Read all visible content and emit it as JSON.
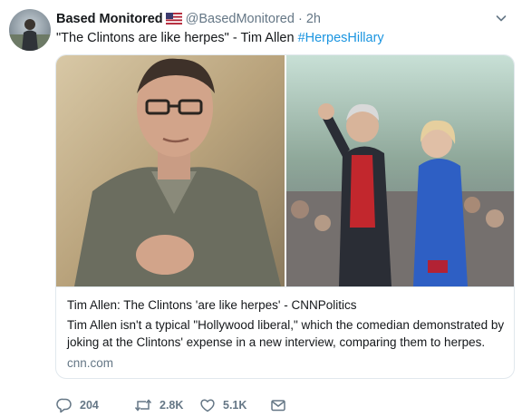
{
  "tweet": {
    "display_name": "Based Monitored",
    "handle": "@BasedMonitored",
    "separator": "·",
    "time": "2h",
    "text": "\"The Clintons are like herpes\" - Tim Allen ",
    "hashtag": "#HerpesHillary"
  },
  "card": {
    "title": "Tim Allen: The Clintons 'are like herpes' - CNNPolitics",
    "description": "Tim Allen isn't a typical \"Hollywood liberal,\" which the comedian demonstrated by joking at the Clintons' expense in a new interview, comparing them to herpes.",
    "domain": "cnn.com"
  },
  "actions": {
    "replies": "204",
    "retweets": "2.8K",
    "likes": "5.1K"
  },
  "colors": {
    "accent": "#1b95e0",
    "secondary_text": "#657786",
    "border": "#e1e8ed"
  },
  "icons": [
    "flag-us-icon",
    "chevron-down-icon",
    "reply-icon",
    "retweet-icon",
    "like-icon",
    "message-icon"
  ]
}
